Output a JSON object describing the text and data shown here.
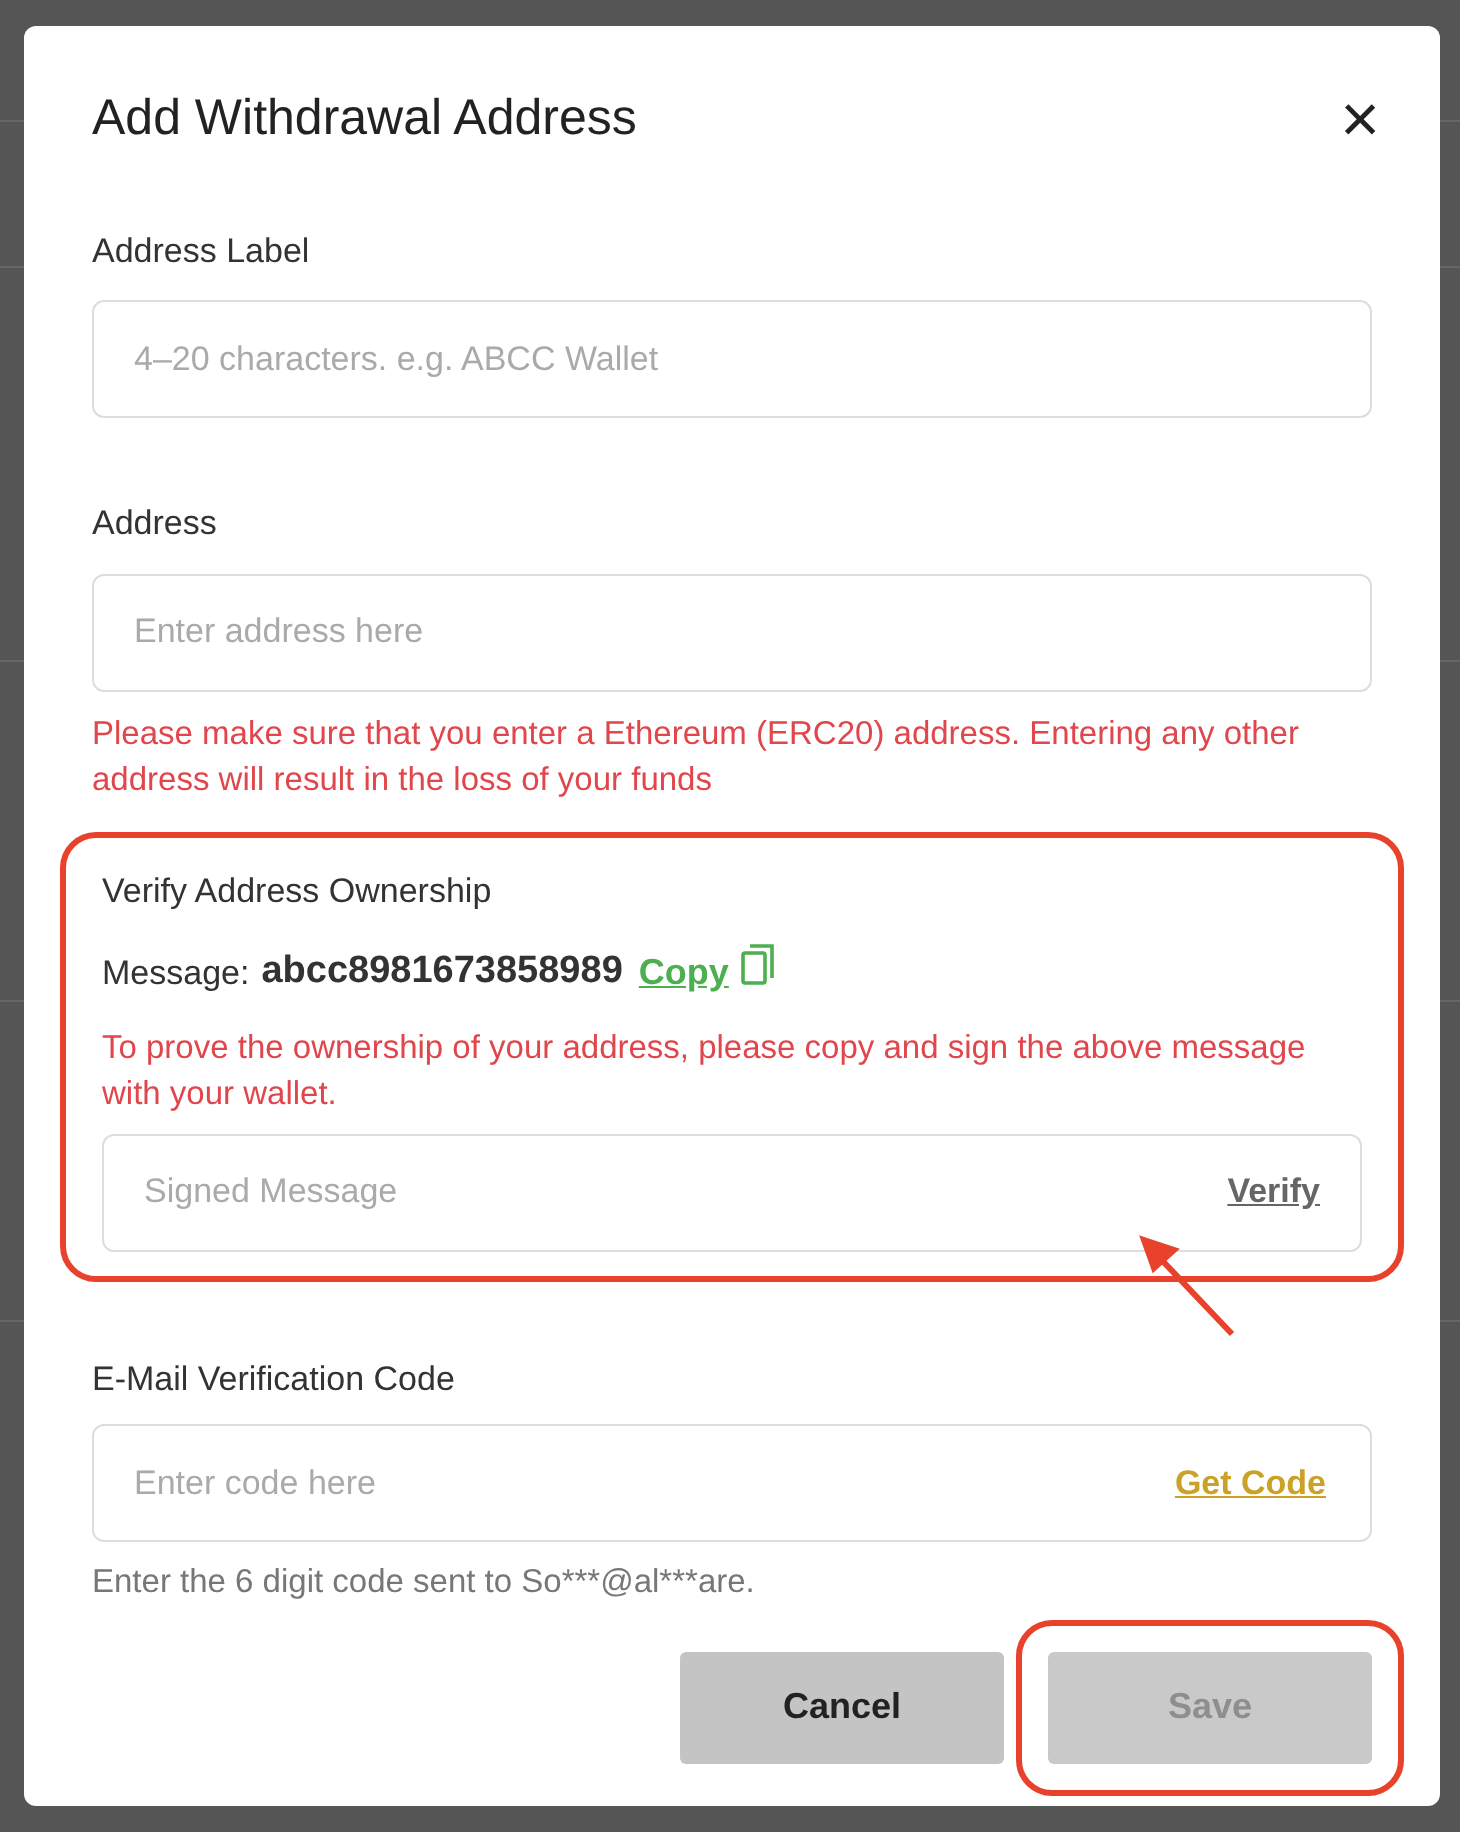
{
  "dialog": {
    "title": "Add Withdrawal Address",
    "close": "×"
  },
  "address_label": {
    "label": "Address Label",
    "placeholder": "4–20 characters. e.g. ABCC Wallet"
  },
  "address": {
    "label": "Address",
    "placeholder": "Enter address here",
    "warning": "Please make sure that you enter a Ethereum (ERC20) address. Entering any other address will result in the loss of your funds"
  },
  "verify": {
    "title": "Verify Address Ownership",
    "message_label": "Message:",
    "message": "abcc8981673858989",
    "copy": "Copy",
    "instruction": "To prove the ownership of your address, please copy and sign the above message with your wallet.",
    "placeholder": "Signed Message",
    "action": "Verify",
    "highlighted": true
  },
  "email_code": {
    "label": "E-Mail Verification Code",
    "placeholder": "Enter code here",
    "action": "Get Code",
    "hint": "Enter the 6 digit code sent to So***@al***are."
  },
  "buttons": [
    {
      "label": "Cancel",
      "kind": "secondary",
      "disabled": false,
      "highlighted": false
    },
    {
      "label": "Save",
      "kind": "primary",
      "disabled": true,
      "highlighted": true
    }
  ]
}
